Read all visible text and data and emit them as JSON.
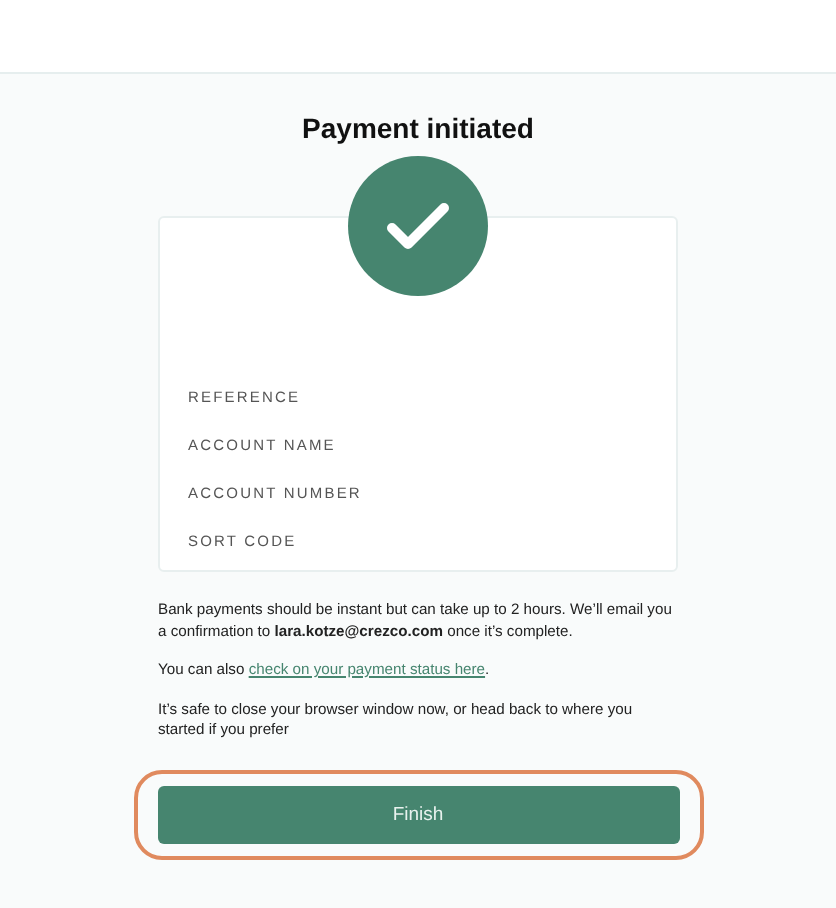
{
  "title": "Payment initiated",
  "details": [
    {
      "label": "REFERENCE"
    },
    {
      "label": "ACCOUNT NAME"
    },
    {
      "label": "ACCOUNT NUMBER"
    },
    {
      "label": "SORT CODE"
    }
  ],
  "info": "Bank payments should be instant but can take up to 2 hours. We’ll email you a confirmation to **lara.kotze@crezco.com** once it’s complete.",
  "status": {
    "before": "You can also ",
    "link": "check on your payment status here",
    "after": "."
  },
  "note": "It’s safe to close your browser window now, or head back to where you started if you prefer",
  "button": {
    "label": "Finish",
    "focused": true
  }
}
